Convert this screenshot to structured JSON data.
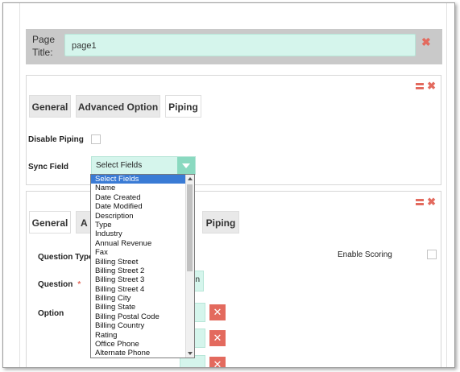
{
  "page_title": {
    "label": "Page Title:",
    "value": "page1"
  },
  "panel1": {
    "tabs": [
      "General",
      "Advanced Option",
      "Piping"
    ],
    "disable_piping_label": "Disable Piping",
    "sync_field_label": "Sync Field",
    "sync_field_value": "Select Fields"
  },
  "panel2": {
    "tabs": [
      "General",
      "A",
      "Piping"
    ],
    "question_type_label": "Question Type",
    "enable_scoring_label": "Enable Scoring",
    "question_label": "Question",
    "required_mark": "*",
    "question_value_tail": "n",
    "option_label": "Option"
  },
  "dropdown": {
    "items": [
      "Select Fields",
      "Name",
      "Date Created",
      "Date Modified",
      "Description",
      "Type",
      "Industry",
      "Annual Revenue",
      "Fax",
      "Billing Street",
      "Billing Street 2",
      "Billing Street 3",
      "Billing Street 4",
      "Billing City",
      "Billing State",
      "Billing Postal Code",
      "Billing Country",
      "Rating",
      "Office Phone",
      "Alternate Phone"
    ],
    "selected_index": 0
  },
  "colors": {
    "accent": "#8ad9c0",
    "field_bg": "#d5f5ec",
    "danger": "#e36a5e",
    "selection": "#3a7bd5"
  },
  "icons": [
    "close-icon",
    "reorder-icon",
    "chevron-down-icon"
  ]
}
